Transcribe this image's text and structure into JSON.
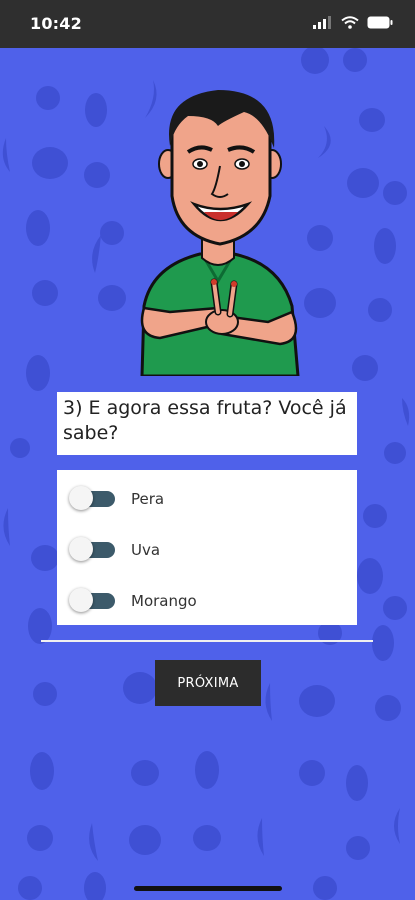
{
  "status_bar": {
    "time": "10:42"
  },
  "question": {
    "text": "3) E agora essa fruta? Você já sabe?"
  },
  "options": [
    {
      "label": "Pera",
      "selected": false
    },
    {
      "label": "Uva",
      "selected": false
    },
    {
      "label": "Morango",
      "selected": false
    }
  ],
  "next_button": {
    "label": "PRÓXIMA"
  },
  "colors": {
    "background": "#4f61ea",
    "pattern": "#3f50d4",
    "shirt": "#1f9a4e",
    "toggle_track": "#3c5a6a",
    "button": "#2c2c2c"
  },
  "icons": [
    "signal-icon",
    "wifi-icon",
    "battery-icon"
  ]
}
